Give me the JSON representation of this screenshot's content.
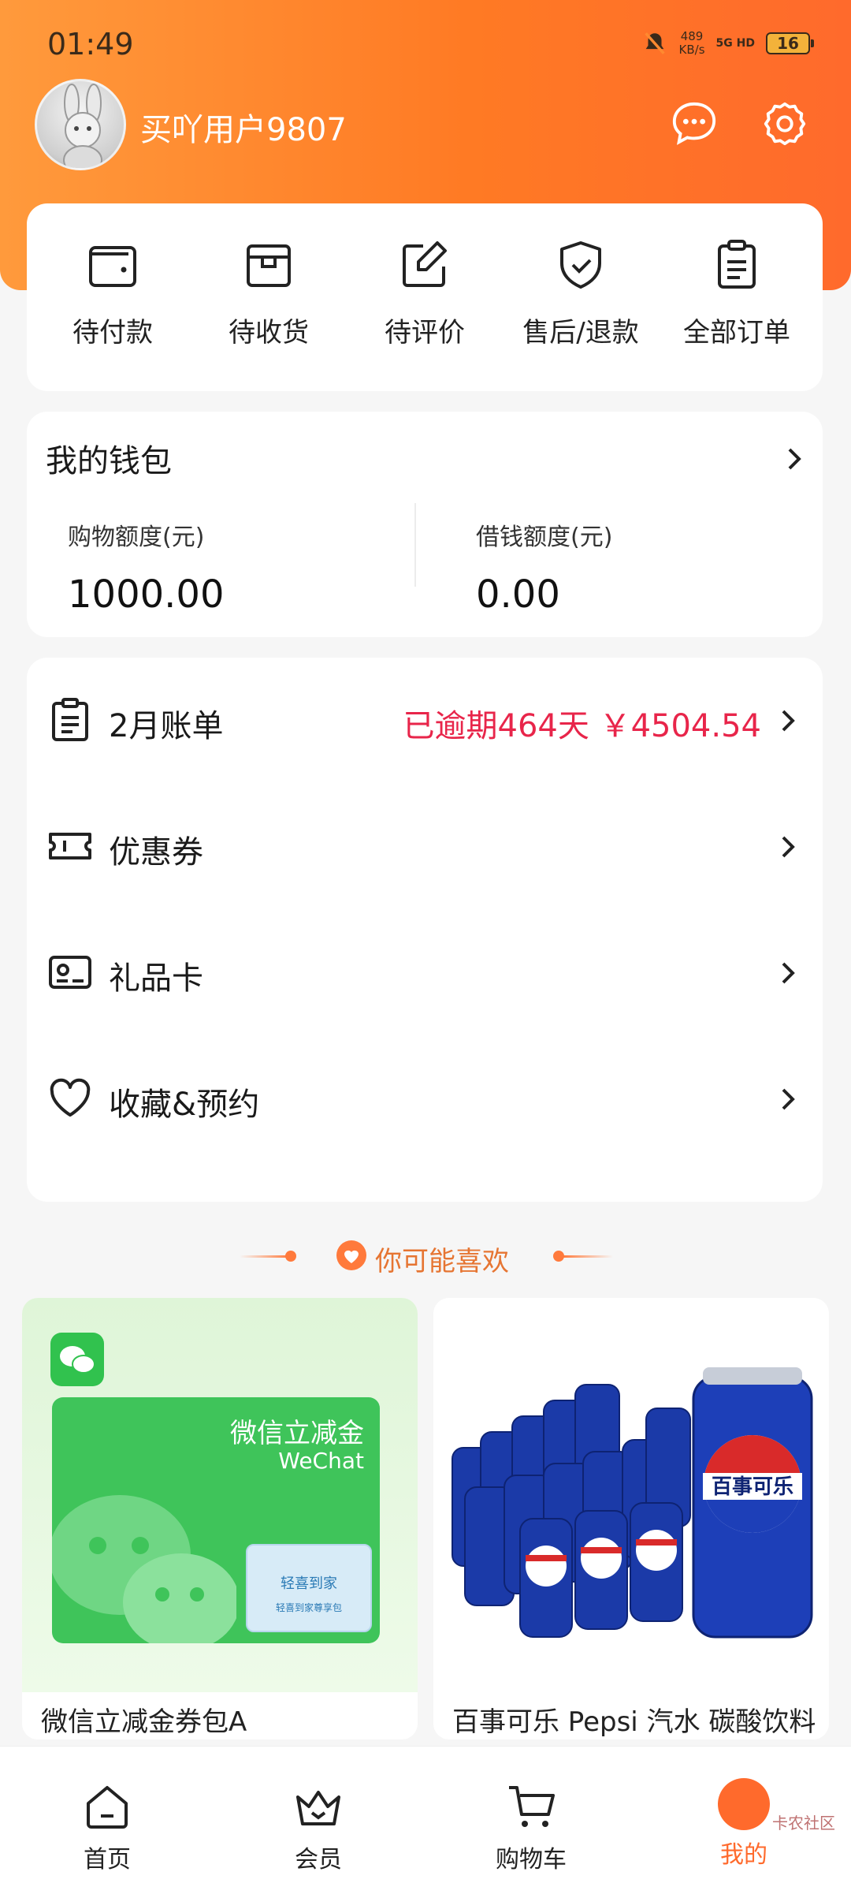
{
  "status_bar": {
    "time": "01:49",
    "speed_value": "489",
    "speed_unit": "KB/s",
    "network": "5G HD",
    "battery": "16"
  },
  "profile": {
    "username": "买吖用户9807"
  },
  "orders": [
    {
      "label": "待付款",
      "icon": "wallet-icon"
    },
    {
      "label": "待收货",
      "icon": "box-icon"
    },
    {
      "label": "待评价",
      "icon": "edit-icon"
    },
    {
      "label": "售后/退款",
      "icon": "shield-check-icon"
    },
    {
      "label": "全部订单",
      "icon": "clipboard-icon"
    }
  ],
  "wallet": {
    "title": "我的钱包",
    "shopping_label": "购物额度(元)",
    "shopping_value": "1000.00",
    "loan_label": "借钱额度(元)",
    "loan_value": "0.00"
  },
  "menu": {
    "bill": {
      "label": "2月账单",
      "value": "已逾期464天 ￥4504.54"
    },
    "coupon": {
      "label": "优惠券"
    },
    "giftcard": {
      "label": "礼品卡"
    },
    "favorites": {
      "label": "收藏&预约"
    }
  },
  "recommend": {
    "title": "你可能喜欢"
  },
  "products": [
    {
      "name": "微信立减金券包A",
      "img_title": "微信立减金",
      "img_sub": "WeChat",
      "badge_title": "轻喜到家",
      "badge_sub": "轻喜到家尊享包"
    },
    {
      "name": "百事可乐 Pepsi 汽水 碳酸饮料",
      "brand_text": "百事可乐"
    }
  ],
  "tabbar": [
    {
      "label": "首页",
      "icon": "home-icon"
    },
    {
      "label": "会员",
      "icon": "crown-icon"
    },
    {
      "label": "购物车",
      "icon": "cart-icon"
    },
    {
      "label": "我的",
      "icon": "me-icon"
    }
  ],
  "watermark": "卡农社区",
  "colors": {
    "accent": "#ff6a2c",
    "overdue": "#e8254a",
    "wechat_green": "#31c24e"
  }
}
